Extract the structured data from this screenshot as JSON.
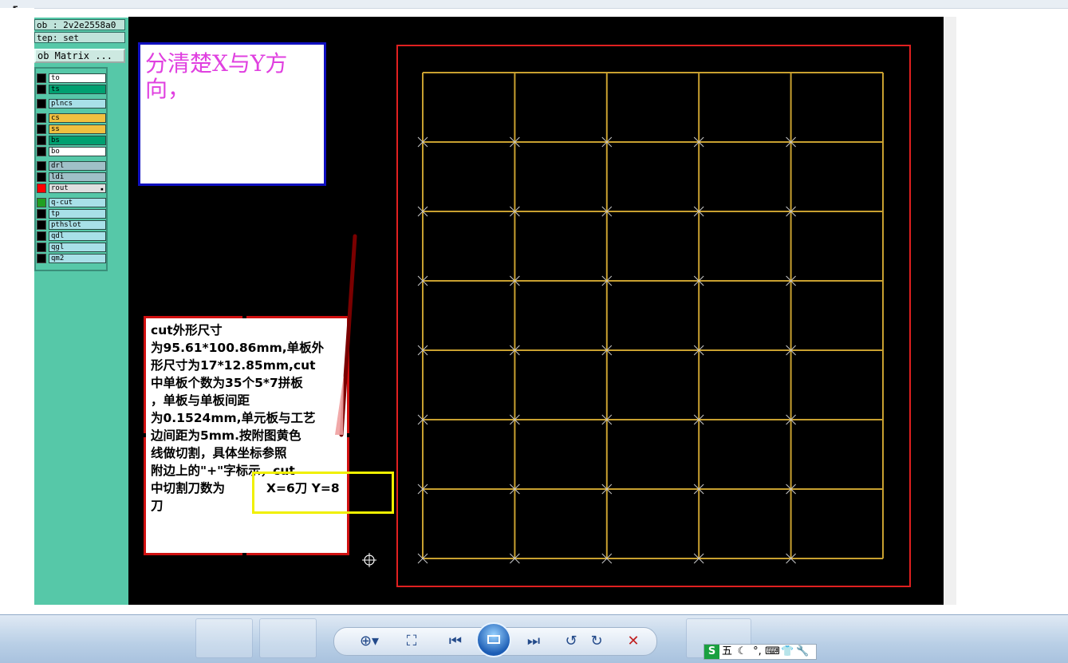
{
  "left_panel": {
    "job_label": "ob : 2v2e2558a0",
    "step_label": "tep: set",
    "matrix_button": "ob Matrix ...",
    "layers": [
      {
        "name": "to",
        "color": "#ffffff",
        "swatch": "#000000",
        "mark": ""
      },
      {
        "name": "ts",
        "color": "#00a070",
        "swatch": "#000000",
        "mark": ""
      },
      {
        "name": "plncs",
        "color": "#a8e0e8",
        "swatch": "#000000",
        "mark": ""
      },
      {
        "name": "cs",
        "color": "#f0c040",
        "swatch": "#000000",
        "mark": ""
      },
      {
        "name": "ss",
        "color": "#f0c040",
        "swatch": "#000000",
        "mark": ""
      },
      {
        "name": "bs",
        "color": "#00a070",
        "swatch": "#000000",
        "mark": ""
      },
      {
        "name": "bo",
        "color": "#ffffff",
        "swatch": "#000000",
        "mark": ""
      },
      {
        "name": "drl",
        "color": "#a0c0c8",
        "swatch": "#000000",
        "mark": ""
      },
      {
        "name": "ldi",
        "color": "#a0c0c8",
        "swatch": "#000000",
        "mark": ""
      },
      {
        "name": "rout",
        "color": "#e0e0e0",
        "swatch": "#ff0000",
        "mark": "▪"
      },
      {
        "name": "q-cut",
        "color": "#a8e0e8",
        "swatch": "#20a020",
        "mark": ""
      },
      {
        "name": "tp",
        "color": "#a8e0e8",
        "swatch": "#000000",
        "mark": ""
      },
      {
        "name": "pthslot",
        "color": "#a8e0e8",
        "swatch": "#000000",
        "mark": ""
      },
      {
        "name": "qdl",
        "color": "#a8e0e8",
        "swatch": "#000000",
        "mark": ""
      },
      {
        "name": "qgl",
        "color": "#a8e0e8",
        "swatch": "#000000",
        "mark": ""
      },
      {
        "name": "qm2",
        "color": "#a8e0e8",
        "swatch": "#000000",
        "mark": ""
      }
    ]
  },
  "note_text": "分清楚X与Y方向，",
  "callout_lines": [
    "cut外形尺寸",
    "为95.61*100.86mm,单板外",
    "形尺寸为17*12.85mm,cut",
    "中单板个数为35个5*7拼板",
    "，单板与单板间距",
    "为0.1524mm,单元板与工艺",
    "边间距为5mm.按附图黄色",
    "线做切割，具体坐标参照",
    "附边上的\"+\"字标示，cut",
    "中切割刀数为",
    "刀"
  ],
  "answer_text": "X=6刀 Y=8",
  "colors": {
    "canvas": "#000000",
    "grid_line": "#c8a030",
    "border": "#e02020",
    "cross": "#c8c8c8"
  },
  "grid": {
    "columns": 5,
    "rows": 7
  },
  "viewer_controls": [
    "zoom-icon",
    "fit-icon",
    "previous-icon",
    "slideshow-icon",
    "next-icon",
    "rotate-left-icon",
    "rotate-right-icon",
    "delete-icon"
  ],
  "ime_items": [
    "S",
    "五",
    "☾",
    "°,",
    "⌨",
    "👕",
    "🔧"
  ]
}
